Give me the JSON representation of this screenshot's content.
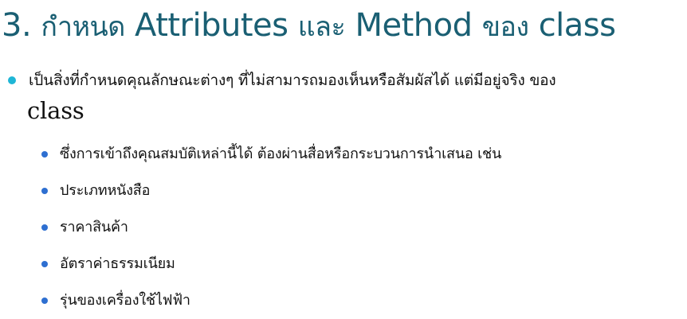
{
  "title": {
    "number": "3.",
    "thai1": "กำหนด",
    "en1": "Attributes",
    "thai2": "และ",
    "en2": "Method",
    "thai3": "ของ",
    "en3": "class"
  },
  "bullet_main": {
    "text": "เป็นสิ่งที่กำหนดคุณลักษณะต่างๆ ที่ไม่สามารถมองเห็นหรือสัมผัสได้ แต่มีอยู่จริง ของ",
    "text_en": "class"
  },
  "sub_bullets": [
    {
      "text": "ซึ่งการเข้าถึงคุณสมบัติเหล่านี้ได้ ต้องผ่านสื่อหรือกระบวนการนำเสนอ เช่น"
    },
    {
      "text": "ประเภทหนังสือ"
    },
    {
      "text": "ราคาสินค้า"
    },
    {
      "text": "อัตราค่าธรรมเนียม"
    },
    {
      "text": "รุ่นของเครื่องใช้ไฟฟ้า"
    }
  ],
  "colors": {
    "title": "#1a5f73",
    "bullet_level1": "#1fb6d6",
    "bullet_level2": "#2e6fd1",
    "text": "#111111"
  }
}
